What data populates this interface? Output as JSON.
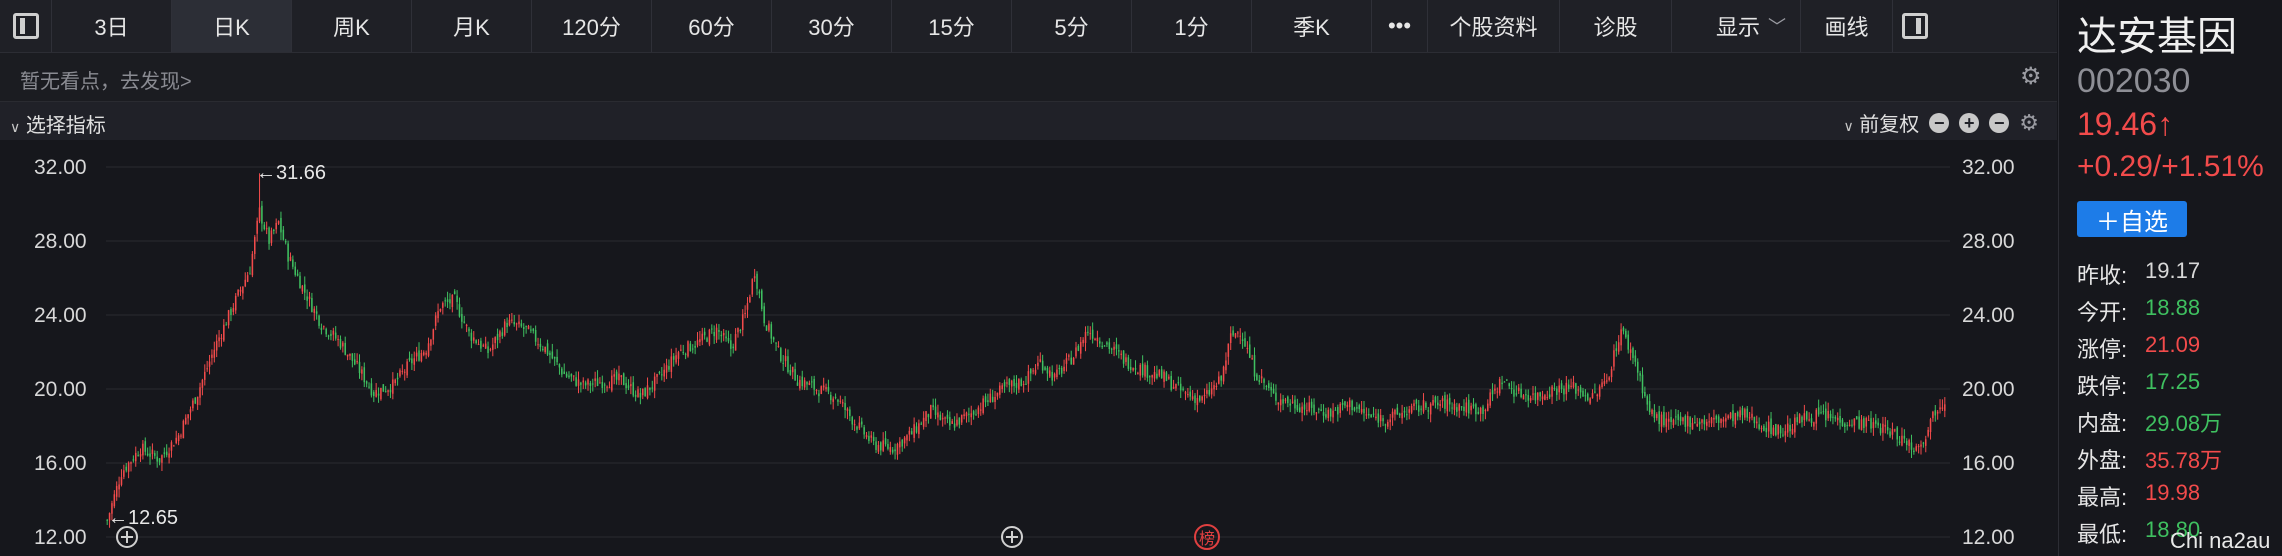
{
  "tabs": [
    "3日",
    "日K",
    "周K",
    "月K",
    "120分",
    "60分",
    "30分",
    "15分",
    "5分",
    "1分",
    "季K",
    "•••",
    "个股资料",
    "诊股"
  ],
  "active_tab": 1,
  "toolbar": {
    "display_label": "显示",
    "draw_label": "画线"
  },
  "view_hint": "暂无看点，去发现>",
  "indicator": {
    "select_label": "选择指标",
    "adjust_label": "前复权"
  },
  "stock": {
    "name": "达安基因",
    "code": "002030",
    "price": "19.46↑",
    "change": "+0.29/+1.51%",
    "watch_label": "＋自选",
    "stats": [
      {
        "label": "昨收:",
        "value": "19.17",
        "tone": "neutral"
      },
      {
        "label": "今开:",
        "value": "18.88",
        "tone": "green"
      },
      {
        "label": "涨停:",
        "value": "21.09",
        "tone": "red"
      },
      {
        "label": "跌停:",
        "value": "17.25",
        "tone": "green"
      },
      {
        "label": "内盘:",
        "value": "29.08万",
        "tone": "green"
      },
      {
        "label": "外盘:",
        "value": "35.78万",
        "tone": "red"
      },
      {
        "label": "最高:",
        "value": "19.98",
        "tone": "red"
      },
      {
        "label": "最低:",
        "value": "18.80",
        "tone": "green"
      }
    ]
  },
  "watermark": "Chi na2au",
  "colors": {
    "up": "#f24b4b",
    "down": "#3fc060",
    "accent": "#1d7ce8",
    "background": "#16171c"
  },
  "chart_data": {
    "type": "candlestick",
    "ylim": [
      12,
      32
    ],
    "yticks": [
      "32.00",
      "28.00",
      "24.00",
      "20.00",
      "16.00",
      "12.00"
    ],
    "high_annotation": "←31.66",
    "low_annotation": "←12.65",
    "rank_badge": "榜",
    "close_path": [
      [
        0,
        12.9
      ],
      [
        6,
        15.5
      ],
      [
        14,
        16.8
      ],
      [
        22,
        16.2
      ],
      [
        30,
        17.5
      ],
      [
        38,
        19.8
      ],
      [
        46,
        22.5
      ],
      [
        54,
        24.8
      ],
      [
        60,
        26.5
      ],
      [
        64,
        29.6
      ],
      [
        68,
        28.0
      ],
      [
        72,
        29.0
      ],
      [
        76,
        27.2
      ],
      [
        82,
        25.5
      ],
      [
        90,
        23.5
      ],
      [
        98,
        22.5
      ],
      [
        106,
        21.0
      ],
      [
        112,
        19.8
      ],
      [
        120,
        20.2
      ],
      [
        128,
        21.5
      ],
      [
        134,
        22.2
      ],
      [
        140,
        24.5
      ],
      [
        146,
        24.8
      ],
      [
        152,
        23.0
      ],
      [
        160,
        22.0
      ],
      [
        168,
        23.6
      ],
      [
        176,
        23.2
      ],
      [
        184,
        22.2
      ],
      [
        192,
        20.8
      ],
      [
        200,
        20.2
      ],
      [
        208,
        20.4
      ],
      [
        216,
        20.5
      ],
      [
        224,
        19.6
      ],
      [
        232,
        20.6
      ],
      [
        240,
        22.0
      ],
      [
        248,
        22.5
      ],
      [
        256,
        23.2
      ],
      [
        262,
        22.2
      ],
      [
        268,
        24.0
      ],
      [
        272,
        26.4
      ],
      [
        276,
        23.8
      ],
      [
        282,
        22.0
      ],
      [
        290,
        20.5
      ],
      [
        298,
        20.0
      ],
      [
        306,
        19.6
      ],
      [
        314,
        18.2
      ],
      [
        322,
        17.0
      ],
      [
        330,
        16.8
      ],
      [
        338,
        17.6
      ],
      [
        346,
        18.8
      ],
      [
        354,
        18.0
      ],
      [
        362,
        18.6
      ],
      [
        370,
        19.4
      ],
      [
        378,
        20.1
      ],
      [
        386,
        20.5
      ],
      [
        392,
        21.5
      ],
      [
        398,
        20.6
      ],
      [
        406,
        21.8
      ],
      [
        412,
        23.2
      ],
      [
        420,
        22.4
      ],
      [
        428,
        21.5
      ],
      [
        436,
        21.0
      ],
      [
        444,
        20.6
      ],
      [
        452,
        19.8
      ],
      [
        460,
        19.4
      ],
      [
        468,
        20.5
      ],
      [
        472,
        22.8
      ],
      [
        476,
        23.2
      ],
      [
        482,
        21.0
      ],
      [
        490,
        19.6
      ],
      [
        498,
        19.2
      ],
      [
        506,
        18.9
      ],
      [
        514,
        18.7
      ],
      [
        522,
        19.2
      ],
      [
        530,
        18.5
      ],
      [
        538,
        18.4
      ],
      [
        546,
        18.8
      ],
      [
        554,
        19.1
      ],
      [
        562,
        19.2
      ],
      [
        570,
        19.0
      ],
      [
        578,
        18.9
      ],
      [
        586,
        20.5
      ],
      [
        592,
        19.8
      ],
      [
        600,
        19.6
      ],
      [
        608,
        20.0
      ],
      [
        616,
        20.1
      ],
      [
        624,
        19.5
      ],
      [
        630,
        20.5
      ],
      [
        636,
        23.2
      ],
      [
        642,
        21.5
      ],
      [
        648,
        18.7
      ],
      [
        656,
        18.1
      ],
      [
        664,
        18.3
      ],
      [
        672,
        18.2
      ],
      [
        680,
        18.4
      ],
      [
        688,
        18.6
      ],
      [
        696,
        18.0
      ],
      [
        704,
        17.7
      ],
      [
        712,
        18.4
      ],
      [
        720,
        18.6
      ],
      [
        728,
        18.3
      ],
      [
        736,
        18.2
      ],
      [
        744,
        18.0
      ],
      [
        752,
        17.5
      ],
      [
        760,
        16.8
      ],
      [
        764,
        17.6
      ],
      [
        768,
        18.9
      ],
      [
        772,
        19.46
      ]
    ]
  }
}
